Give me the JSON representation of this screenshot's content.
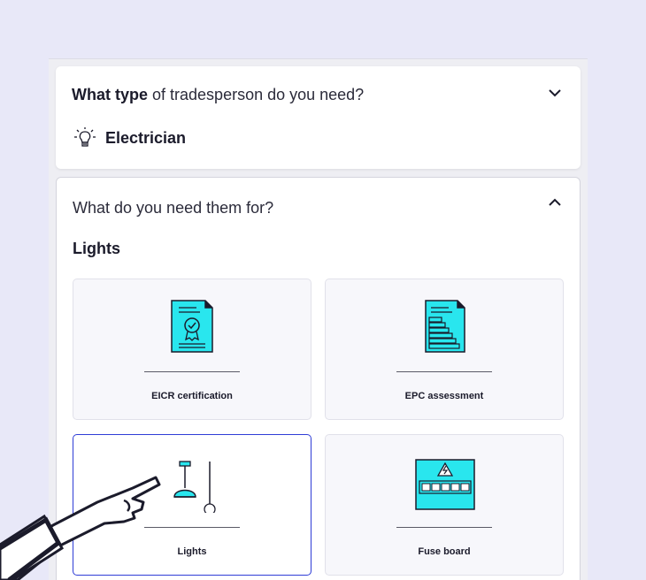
{
  "step1": {
    "question_bold": "What type",
    "question_rest": " of tradesperson do you need?",
    "answer": "Electrician",
    "expanded": false
  },
  "step2": {
    "question": "What do you need them for?",
    "section_title": "Lights",
    "expanded": true,
    "options": [
      {
        "label": "EICR certification",
        "icon": "certificate-icon",
        "selected": false
      },
      {
        "label": "EPC assessment",
        "icon": "energy-rating-icon",
        "selected": false
      },
      {
        "label": "Lights",
        "icon": "pendant-light-icon",
        "selected": true
      },
      {
        "label": "Fuse board",
        "icon": "fuse-board-icon",
        "selected": false
      }
    ]
  },
  "colors": {
    "background": "#e8e8f8",
    "accent_cyan": "#29e6ee",
    "selected_border": "#2f3dd6"
  }
}
